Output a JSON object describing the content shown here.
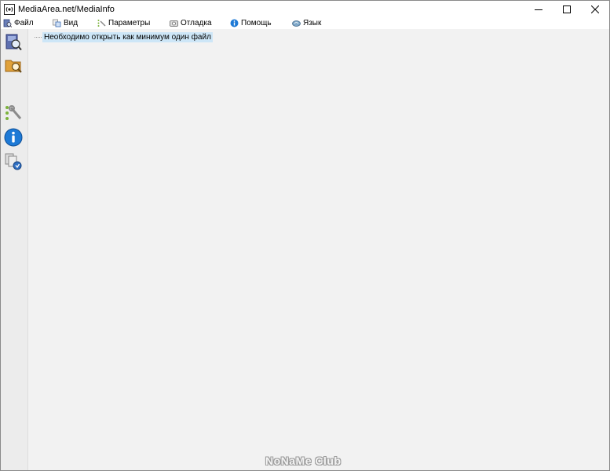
{
  "window": {
    "title": "MediaArea.net/MediaInfo",
    "controls": {
      "minimize_icon": "minimize-icon",
      "maximize_icon": "maximize-icon",
      "close_icon": "close-icon"
    }
  },
  "menu": {
    "items": [
      {
        "label": "Файл",
        "icon": "file-icon"
      },
      {
        "label": "Вид",
        "icon": "view-icon"
      },
      {
        "label": "Параметры",
        "icon": "settings-icon"
      },
      {
        "label": "Отладка",
        "icon": "debug-icon"
      },
      {
        "label": "Помощь",
        "icon": "help-icon"
      },
      {
        "label": "Язык",
        "icon": "language-icon"
      }
    ]
  },
  "toolbar": {
    "buttons": [
      {
        "icon": "open-file-icon"
      },
      {
        "icon": "open-folder-icon"
      },
      {
        "icon": "preferences-icon"
      },
      {
        "icon": "about-info-icon"
      },
      {
        "icon": "export-icon"
      }
    ]
  },
  "content": {
    "message": "Необходимо открыть как минимум один файл"
  },
  "watermark": {
    "text": "NoNaMe Club"
  },
  "colors": {
    "selection": "#cde6f7",
    "background": "#f2f2f2",
    "info_blue": "#1e7ad6"
  }
}
